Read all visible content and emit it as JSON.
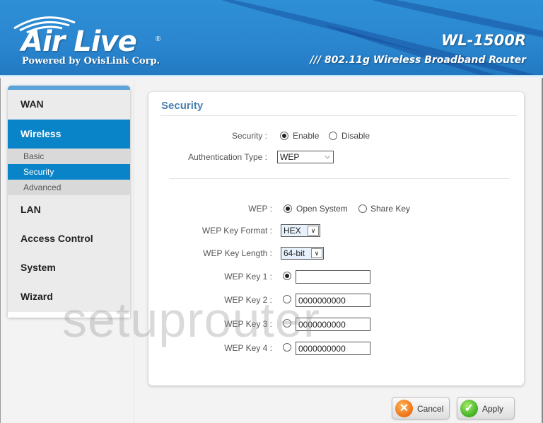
{
  "header": {
    "brand": "Air Live",
    "brand_registered": "®",
    "brand_tagline": "Powered by OvisLink Corp.",
    "model": "WL-1500R",
    "model_description": "/// 802.11g Wireless Broadband Router"
  },
  "sidebar": {
    "items": [
      {
        "label": "WAN",
        "active": false
      },
      {
        "label": "Wireless",
        "active": true,
        "subitems": [
          {
            "label": "Basic",
            "active": false
          },
          {
            "label": "Security",
            "active": true
          },
          {
            "label": "Advanced",
            "active": false
          }
        ]
      },
      {
        "label": "LAN",
        "active": false
      },
      {
        "label": "Access Control",
        "active": false
      },
      {
        "label": "System",
        "active": false
      },
      {
        "label": "Wizard",
        "active": false
      }
    ]
  },
  "panel": {
    "title": "Security",
    "security": {
      "label": "Security :",
      "options": [
        "Enable",
        "Disable"
      ],
      "selected": "Enable"
    },
    "auth_type": {
      "label": "Authentication Type :",
      "value": "WEP"
    },
    "wep": {
      "label": "WEP :",
      "options": [
        "Open System",
        "Share Key"
      ],
      "selected": "Open System"
    },
    "key_format": {
      "label": "WEP Key Format :",
      "value": "HEX"
    },
    "key_length": {
      "label": "WEP Key Length :",
      "value": "64-bit"
    },
    "keys": [
      {
        "label": "WEP Key 1 :",
        "value": "",
        "selected": true
      },
      {
        "label": "WEP Key 2 :",
        "value": "0000000000",
        "selected": false
      },
      {
        "label": "WEP Key 3 :",
        "value": "0000000000",
        "selected": false
      },
      {
        "label": "WEP Key 4 :",
        "value": "0000000000",
        "selected": false
      }
    ]
  },
  "buttons": {
    "cancel": "Cancel",
    "apply": "Apply"
  },
  "watermark": "setuprouter",
  "colors": {
    "header_blue": "#2a86cf",
    "nav_active": "#0a84c8",
    "title_blue": "#4a7fae",
    "cancel_orange": "#f07a1e",
    "apply_green": "#4cb82a"
  }
}
